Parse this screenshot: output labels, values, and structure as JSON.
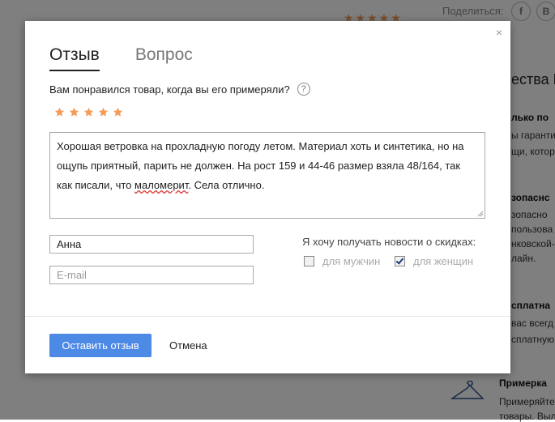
{
  "background": {
    "share_label": "Поделиться:",
    "social": [
      "f",
      "B"
    ],
    "stars": "★★★★★",
    "section_title": "ества L",
    "blocks": [
      {
        "title": "лько по",
        "lines": [
          "ы гаранти",
          "щи, котор"
        ]
      },
      {
        "title": "зопаснс",
        "lines": [
          "зопасно",
          "пользова",
          "нковской-",
          "лайн."
        ]
      },
      {
        "title": "сплатна",
        "lines": [
          "вас всегд",
          "сплатную"
        ]
      }
    ],
    "fitting_title": "Примерка",
    "fitting_lines": [
      "Примеряйте",
      "товары. Выл"
    ]
  },
  "modal": {
    "close_glyph": "×",
    "tabs": [
      {
        "label": "Отзыв",
        "active": true
      },
      {
        "label": "Вопрос",
        "active": false
      }
    ],
    "question": "Вам понравился товар, когда вы его примеряли?",
    "help_glyph": "?",
    "rating": {
      "value": 5,
      "max": 5,
      "color": "#f39b57"
    },
    "review": {
      "part1": "Хорошая ветровка на прохладную погоду летом. Материал хоть и синтетика, но на ощупь приятный, парить не должен. На рост 159 и 44-46 размер взяла 48/164, так как писали, что ",
      "misspelled": "маломерит",
      "part2": ". Села отлично."
    },
    "name_value": "Анна",
    "email_placeholder": "E-mail",
    "news_label": "Я хочу получать новости о скидках:",
    "checkbox_men": {
      "label": "для мужчин",
      "checked": false
    },
    "checkbox_women": {
      "label": "для женщин",
      "checked": true
    },
    "submit_label": "Оставить отзыв",
    "cancel_label": "Отмена",
    "accent_color": "#4d8ae6"
  }
}
